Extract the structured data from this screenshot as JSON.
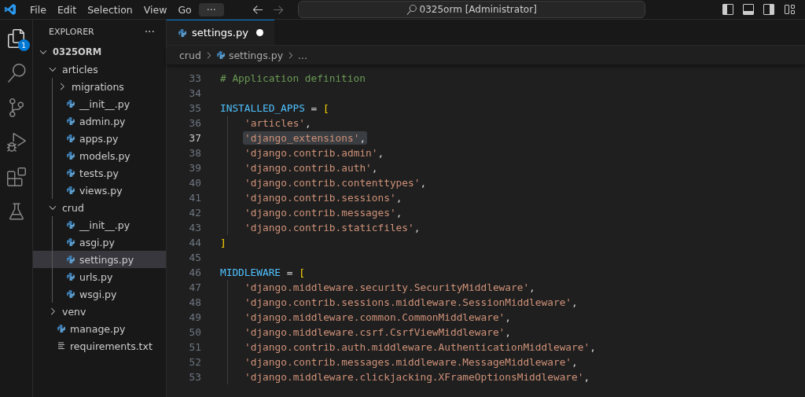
{
  "menu": [
    "File",
    "Edit",
    "Selection",
    "View",
    "Go"
  ],
  "more_menu": "···",
  "command_center": "0325orm [Administrator]",
  "activity_bar": {
    "explorer_badge": "1"
  },
  "sidebar": {
    "title": "EXPLORER",
    "more": "···",
    "tree": [
      {
        "label": "0325ORM",
        "kind": "root",
        "expanded": true,
        "selected": false,
        "children": [
          {
            "label": "articles",
            "kind": "folder",
            "expanded": true,
            "selected": false,
            "children": [
              {
                "label": "migrations",
                "kind": "folder",
                "expanded": false,
                "selected": false
              },
              {
                "label": "__init__.py",
                "kind": "python",
                "selected": false
              },
              {
                "label": "admin.py",
                "kind": "python",
                "selected": false
              },
              {
                "label": "apps.py",
                "kind": "python",
                "selected": false
              },
              {
                "label": "models.py",
                "kind": "python",
                "selected": false
              },
              {
                "label": "tests.py",
                "kind": "python",
                "selected": false
              },
              {
                "label": "views.py",
                "kind": "python",
                "selected": false
              }
            ]
          },
          {
            "label": "crud",
            "kind": "folder",
            "expanded": true,
            "selected": false,
            "children": [
              {
                "label": "__init__.py",
                "kind": "python",
                "selected": false
              },
              {
                "label": "asgi.py",
                "kind": "python",
                "selected": false
              },
              {
                "label": "settings.py",
                "kind": "python",
                "selected": true
              },
              {
                "label": "urls.py",
                "kind": "python",
                "selected": false
              },
              {
                "label": "wsgi.py",
                "kind": "python",
                "selected": false
              }
            ]
          },
          {
            "label": "venv",
            "kind": "folder",
            "expanded": false,
            "selected": false
          },
          {
            "label": "manage.py",
            "kind": "python",
            "selected": false
          },
          {
            "label": "requirements.txt",
            "kind": "text",
            "selected": false
          }
        ]
      }
    ]
  },
  "tabs": [
    {
      "label": "settings.py",
      "selected": true,
      "modified": true
    }
  ],
  "breadcrumbs": [
    {
      "label": "crud",
      "kind": "folder"
    },
    {
      "label": "settings.py",
      "kind": "python"
    },
    {
      "label": "...",
      "kind": "more"
    }
  ],
  "code": [
    {
      "number": "33",
      "current": false,
      "tokens": [
        {
          "kind": "comment",
          "text": "# Application definition"
        }
      ]
    },
    {
      "number": "34",
      "current": false
    },
    {
      "number": "35",
      "current": false,
      "tokens": [
        {
          "kind": "name",
          "text": "INSTALLED_APPS"
        },
        {
          "kind": "op",
          "text": " = "
        },
        {
          "kind": "bracket",
          "text": "["
        }
      ],
      "children": [
        {
          "number": "36",
          "current": false,
          "tokens": [
            {
              "kind": "string",
              "text": "'articles'"
            },
            {
              "kind": "op",
              "text": ","
            }
          ]
        },
        {
          "number": "37",
          "current": true,
          "tokens": [
            {
              "kind": "string",
              "text": "'django_extensions'"
            },
            {
              "kind": "op",
              "text": ","
            }
          ]
        },
        {
          "number": "38",
          "current": false,
          "tokens": [
            {
              "kind": "string",
              "text": "'django.contrib.admin'"
            },
            {
              "kind": "op",
              "text": ","
            }
          ]
        },
        {
          "number": "39",
          "current": false,
          "tokens": [
            {
              "kind": "string",
              "text": "'django.contrib.auth'"
            },
            {
              "kind": "op",
              "text": ","
            }
          ]
        },
        {
          "number": "40",
          "current": false,
          "tokens": [
            {
              "kind": "string",
              "text": "'django.contrib.contenttypes'"
            },
            {
              "kind": "op",
              "text": ","
            }
          ]
        },
        {
          "number": "41",
          "current": false,
          "tokens": [
            {
              "kind": "string",
              "text": "'django.contrib.sessions'"
            },
            {
              "kind": "op",
              "text": ","
            }
          ]
        },
        {
          "number": "42",
          "current": false,
          "tokens": [
            {
              "kind": "string",
              "text": "'django.contrib.messages'"
            },
            {
              "kind": "op",
              "text": ","
            }
          ]
        },
        {
          "number": "43",
          "current": false,
          "tokens": [
            {
              "kind": "string",
              "text": "'django.contrib.staticfiles'"
            },
            {
              "kind": "op",
              "text": ","
            }
          ]
        }
      ]
    },
    {
      "number": "44",
      "current": false,
      "tokens": [
        {
          "kind": "bracket",
          "text": "]"
        }
      ]
    },
    {
      "number": "45",
      "current": false
    },
    {
      "number": "46",
      "current": false,
      "tokens": [
        {
          "kind": "name",
          "text": "MIDDLEWARE"
        },
        {
          "kind": "op",
          "text": " = "
        },
        {
          "kind": "bracket",
          "text": "["
        }
      ],
      "children": [
        {
          "number": "47",
          "current": false,
          "tokens": [
            {
              "kind": "string",
              "text": "'django.middleware.security.SecurityMiddleware'"
            },
            {
              "kind": "op",
              "text": ","
            }
          ]
        },
        {
          "number": "48",
          "current": false,
          "tokens": [
            {
              "kind": "string",
              "text": "'django.contrib.sessions.middleware.SessionMiddleware'"
            },
            {
              "kind": "op",
              "text": ","
            }
          ]
        },
        {
          "number": "49",
          "current": false,
          "tokens": [
            {
              "kind": "string",
              "text": "'django.middleware.common.CommonMiddleware'"
            },
            {
              "kind": "op",
              "text": ","
            }
          ]
        },
        {
          "number": "50",
          "current": false,
          "tokens": [
            {
              "kind": "string",
              "text": "'django.middleware.csrf.CsrfViewMiddleware'"
            },
            {
              "kind": "op",
              "text": ","
            }
          ]
        },
        {
          "number": "51",
          "current": false,
          "tokens": [
            {
              "kind": "string",
              "text": "'django.contrib.auth.middleware.AuthenticationMiddleware'"
            },
            {
              "kind": "op",
              "text": ","
            }
          ]
        },
        {
          "number": "52",
          "current": false,
          "tokens": [
            {
              "kind": "string",
              "text": "'django.contrib.messages.middleware.MessageMiddleware'"
            },
            {
              "kind": "op",
              "text": ","
            }
          ]
        },
        {
          "number": "53",
          "current": false,
          "tokens": [
            {
              "kind": "string",
              "text": "'django.middleware.clickjacking.XFrameOptionsMiddleware'"
            },
            {
              "kind": "op",
              "text": ","
            }
          ]
        }
      ]
    }
  ]
}
